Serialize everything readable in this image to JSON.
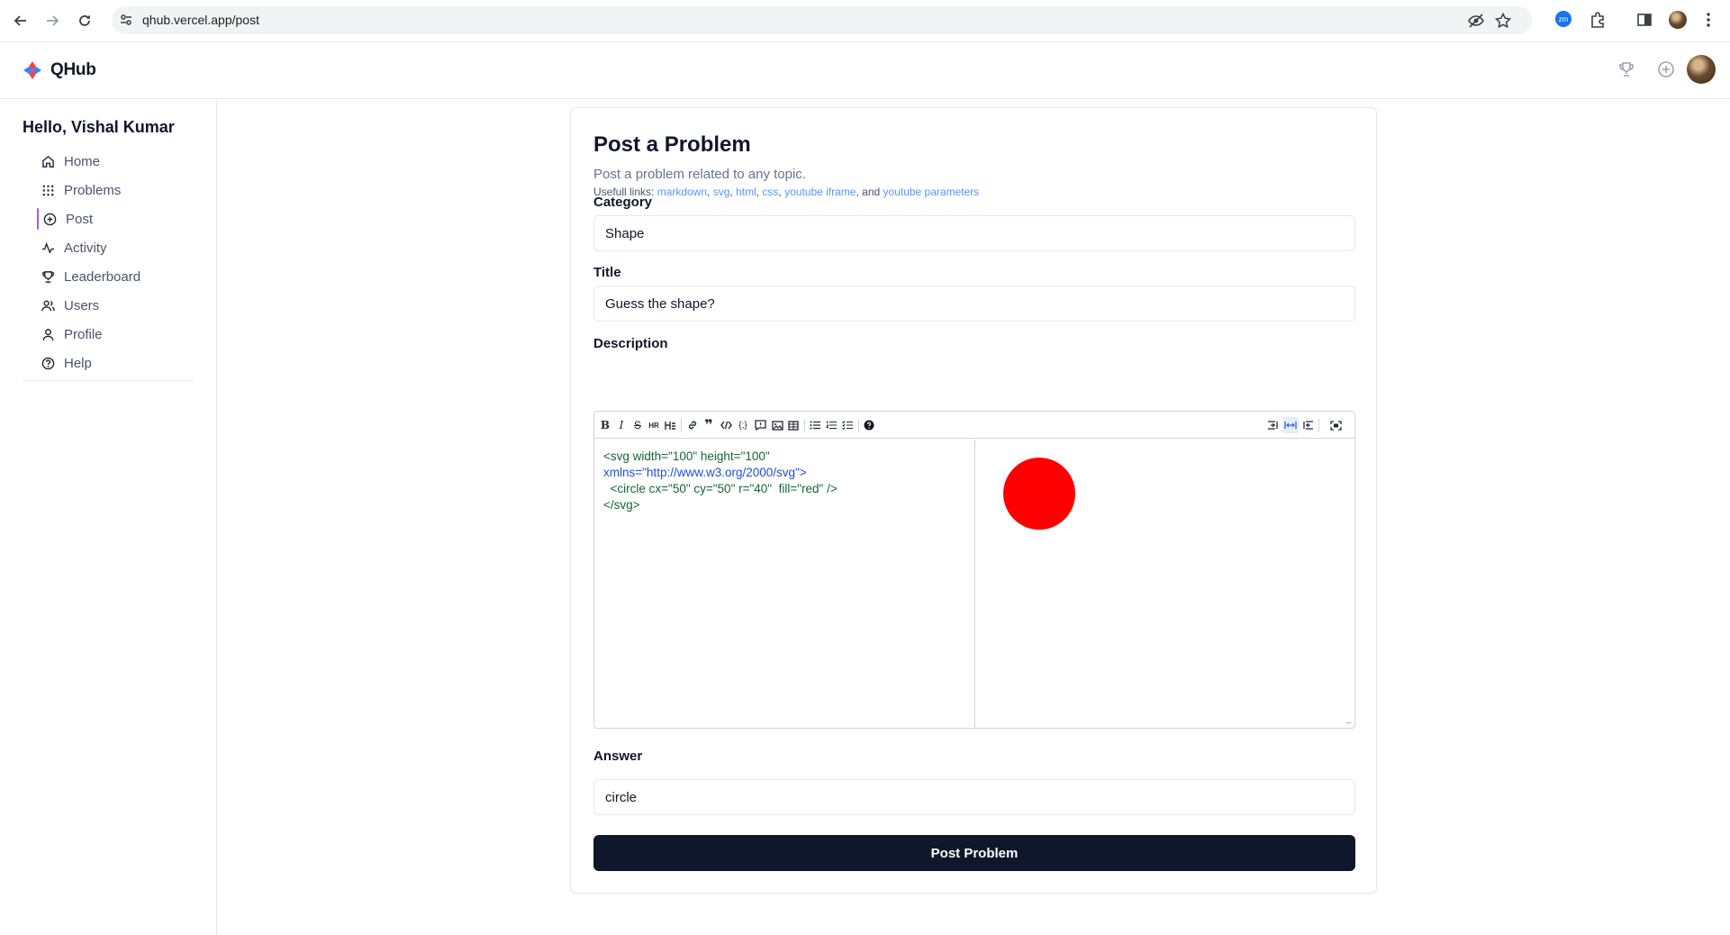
{
  "browser": {
    "url": "qhub.vercel.app/post",
    "extension_badge": "zm"
  },
  "app": {
    "name": "QHub"
  },
  "sidebar": {
    "greeting": "Hello, Vishal Kumar",
    "items": [
      {
        "label": "Home",
        "icon": "home-icon"
      },
      {
        "label": "Problems",
        "icon": "grid-icon"
      },
      {
        "label": "Post",
        "icon": "plus-circle-icon",
        "active": true
      },
      {
        "label": "Activity",
        "icon": "activity-icon"
      },
      {
        "label": "Leaderboard",
        "icon": "trophy-icon"
      },
      {
        "label": "Users",
        "icon": "users-icon"
      },
      {
        "label": "Profile",
        "icon": "user-icon"
      },
      {
        "label": "Help",
        "icon": "help-circle-icon"
      }
    ]
  },
  "form": {
    "title": "Post a Problem",
    "subtitle": "Post a problem related to any topic.",
    "links_prefix": "Usefull links: ",
    "links": [
      "markdown",
      "svg",
      "html",
      "css",
      "youtube iframe",
      "youtube parameters"
    ],
    "links_sep_1": ", ",
    "links_sep_last": ", and ",
    "category_label": "Category",
    "category_value": "Shape",
    "title_label": "Title",
    "title_value": "Guess the shape?",
    "description_label": "Description",
    "description_code": {
      "line1": "<svg width=\"100\" height=\"100\"",
      "line2": "xmlns=\"http://www.w3.org/2000/svg\">",
      "line3": "  <circle cx=\"50\" cy=\"50\" r=\"40\"  fill=\"red\" />",
      "line4": "</svg>"
    },
    "preview_fill": "#ff0000",
    "resize_handle": "...",
    "answer_label": "Answer",
    "answer_value": "circle",
    "submit_label": "Post Problem"
  },
  "colors": {
    "accent": "#a855f7",
    "primary_button": "#0f172a",
    "link": "#3b82f6"
  }
}
